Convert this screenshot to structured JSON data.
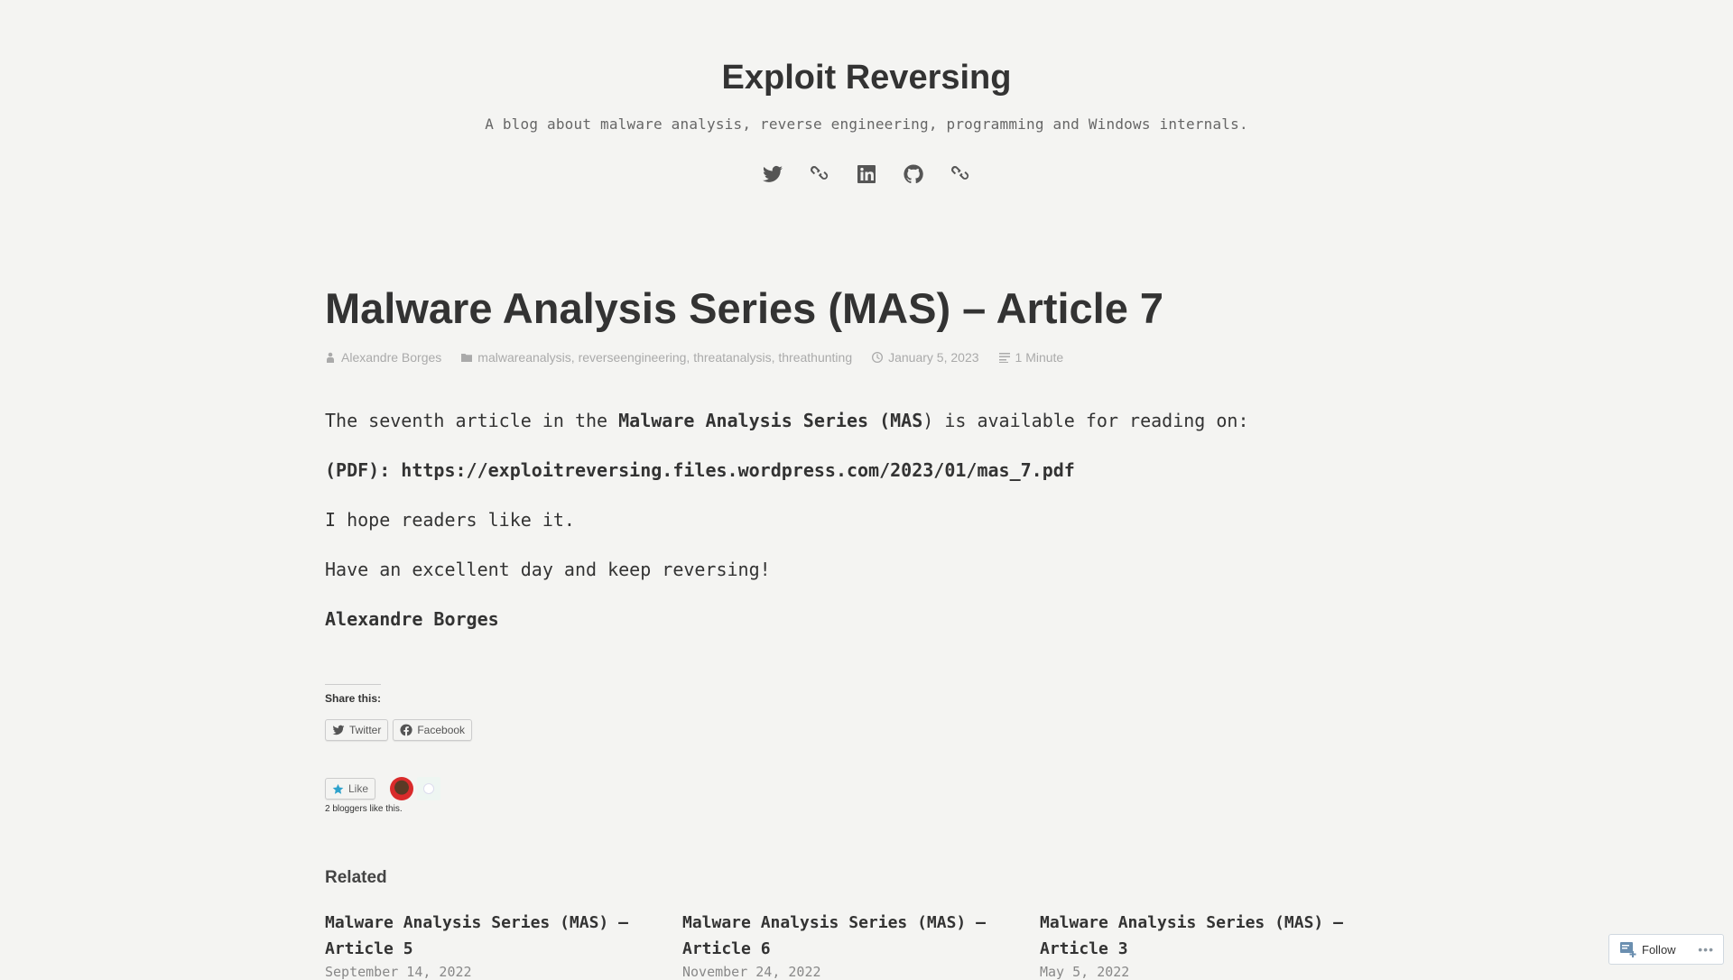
{
  "site": {
    "title": "Exploit Reversing",
    "description": "A blog about malware analysis, reverse engineering, programming and Windows internals."
  },
  "social": [
    {
      "name": "twitter",
      "icon": "twitter-icon"
    },
    {
      "name": "link",
      "icon": "link-icon"
    },
    {
      "name": "linkedin",
      "icon": "linkedin-icon"
    },
    {
      "name": "github",
      "icon": "github-icon"
    },
    {
      "name": "link",
      "icon": "link-icon"
    }
  ],
  "post": {
    "title": "Malware Analysis Series (MAS) – Article 7",
    "meta": {
      "author": "Alexandre Borges",
      "categories": [
        "malwareanalysis",
        "reverseengineering",
        "threatanalysis",
        "threathunting"
      ],
      "date": "January 5, 2023",
      "read_time": "1 Minute"
    },
    "body": {
      "p1_pre": "The seventh article in the ",
      "p1_bold": "Malware Analysis Series (MAS",
      "p1_post": ") is available for reading on:",
      "pdf_label": "(PDF): ",
      "pdf_url": "https://exploitreversing.files.wordpress.com/2023/01/mas_7.pdf",
      "p3": "I hope readers like it.",
      "p4": "Have an excellent day and keep reversing!",
      "signature": "Alexandre Borges"
    }
  },
  "share": {
    "heading": "Share this:",
    "buttons": [
      {
        "label": "Twitter",
        "icon": "twitter-icon"
      },
      {
        "label": "Facebook",
        "icon": "facebook-icon"
      }
    ]
  },
  "likes": {
    "button": "Like",
    "count_text": "2 bloggers like this."
  },
  "related": {
    "heading": "Related",
    "items": [
      {
        "title": "Malware Analysis Series (MAS) – Article 5",
        "date": "September 14, 2022"
      },
      {
        "title": "Malware Analysis Series (MAS) – Article 6",
        "date": "November 24, 2022"
      },
      {
        "title": "Malware Analysis Series (MAS) – Article 3",
        "date": "May 5, 2022"
      }
    ]
  },
  "follow": {
    "label": "Follow",
    "more": "•••"
  }
}
